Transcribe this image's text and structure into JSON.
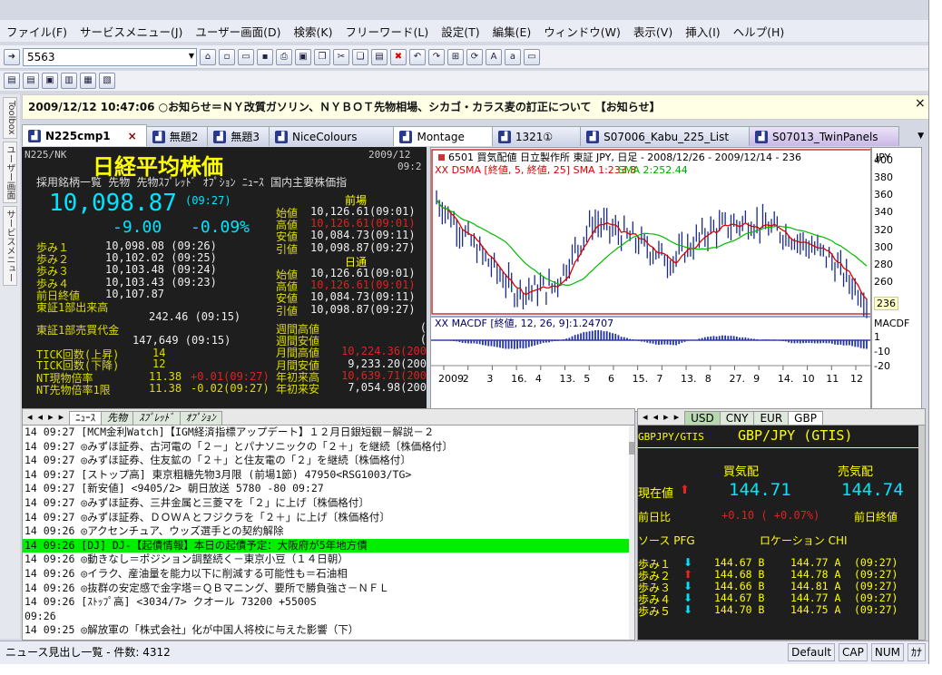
{
  "menu": [
    "ファイル(F)",
    "サービスメニュー(J)",
    "ユーザー画面(D)",
    "検索(K)",
    "フリーワード(L)",
    "設定(T)",
    "編集(E)",
    "ウィンドウ(W)",
    "表示(V)",
    "挿入(I)",
    "ヘルプ(H)"
  ],
  "address": {
    "value": "5563"
  },
  "notice": {
    "text": "2009/12/12 10:47:06 ○お知らせ＝ＮＹ改質ガソリン、ＮＹＢＯＴ先物相場、シカゴ・カラス麦の訂正について 【お知らせ】",
    "close": "×"
  },
  "left_strip": [
    "Toolbox",
    "ユーザー画面",
    "サービスメニュー"
  ],
  "tabs": [
    {
      "label": "N225cmp1",
      "active": true,
      "close": "×"
    },
    {
      "label": "無題2"
    },
    {
      "label": "無題3"
    },
    {
      "label": "NiceColours"
    },
    {
      "label": "Montage"
    },
    {
      "label": "1321①"
    },
    {
      "label": "S07006_Kabu_225_List"
    },
    {
      "label": "S07013_TwinPanels"
    }
  ],
  "quote": {
    "code": "N225/NK",
    "date": "2009/12",
    "time": "09:2",
    "title": "日経平均株価",
    "links": "採用銘柄一覧 先物 先物ｽﾌﾟﾚｯﾄﾞ ｵﾌﾟｼｮﾝ ﾆｭｰｽ 国内主要株価指",
    "price": "10,098.87",
    "price_time": "(09:27)",
    "change": "-9.00",
    "change_pct": "-0.09%",
    "steps": [
      {
        "label": "歩み１",
        "value": "10,098.08 (09:26)"
      },
      {
        "label": "歩み２",
        "value": "10,102.02 (09:25)"
      },
      {
        "label": "歩み３",
        "value": "10,103.48 (09:24)"
      },
      {
        "label": "歩み４",
        "value": "10,103.43 (09:23)"
      },
      {
        "label": "前日終値",
        "value": "10,107.87"
      }
    ],
    "zenba": "前場",
    "sessions_am": [
      {
        "label": "始値",
        "value": "10,126.61(09:01)"
      },
      {
        "label": "高値",
        "value": "10,126.61(09:01)"
      },
      {
        "label": "安値",
        "value": "10,084.73(09:11)"
      },
      {
        "label": "引値",
        "value": "10,098.87(09:27)"
      }
    ],
    "hidori": "日通",
    "sessions_day": [
      {
        "label": "始値",
        "value": "10,126.61(09:01)"
      },
      {
        "label": "高値",
        "value": "10,126.61(09:01)"
      },
      {
        "label": "安値",
        "value": "10,084.73(09:11)"
      },
      {
        "label": "引値",
        "value": "10,098.87(09:27)"
      }
    ],
    "tse_label": "東証1部出来高",
    "tse_value": "242.46 (09:15)",
    "tse_amt_label": "東証1部売買代金",
    "tse_amt_value": "147,649 (09:15)",
    "tick_up": "TICK回数(上昇)",
    "tick_up_v": "14",
    "tick_dn": "TICK回数(下降)",
    "tick_dn_v": "12",
    "nt1": "NT現物倍率",
    "nt1_v": "11.38",
    "nt1_c": "+0.01(09:27)",
    "nt2": "NT先物倍率1限",
    "nt2_v": "11.38",
    "nt2_c": "-0.02(09:27)",
    "weekly": [
      {
        "label": "週間高値",
        "value": "("
      },
      {
        "label": "週間安値",
        "value": "("
      },
      {
        "label": "月間高値",
        "value": "10,224.36(200"
      },
      {
        "label": "月間安値",
        "value": "9,233.20(200"
      },
      {
        "label": "年初来高",
        "value": "10,639.71(200"
      },
      {
        "label": "年初来安",
        "value": "7,054.98(200"
      }
    ]
  },
  "chart": {
    "header": "6501 買気配値 日立製作所 東証 JPY, 日足 - 2008/12/26 - 2009/12/14 - 236",
    "ma_label": "XX DSMA [終値, 5, 終値, 25] SMA 1:233.8",
    "ma2_label": "SMA 2:252.44",
    "currency": "JPY",
    "macd_label": "XX MACDF [終値, 12, 26, 9]:1.24707",
    "macd_axis": "MACDF",
    "price_ticks": [
      "400",
      "380",
      "360",
      "340",
      "320",
      "300",
      "280",
      "260",
      "236"
    ],
    "macd_ticks": [
      "1",
      "-10",
      "-20"
    ],
    "x_ticks": [
      "2009",
      "2",
      "3",
      "16.",
      "4",
      "13.",
      "5",
      "6",
      "15.",
      "7",
      "13.",
      "8",
      "27.",
      "9",
      "14.",
      "10",
      "11",
      "12"
    ]
  },
  "chart_data": {
    "type": "line",
    "title": "6501 買気配値 日立製作所 東証 JPY, 日足 - 2008/12/26 - 2009/12/14 - 236",
    "x": [
      "2009",
      "2",
      "3",
      "4",
      "5",
      "6",
      "7",
      "8",
      "9",
      "10",
      "11",
      "12"
    ],
    "series": [
      {
        "name": "終値",
        "values": [
          355,
          300,
          250,
          255,
          330,
          310,
          285,
          320,
          330,
          315,
          290,
          240
        ]
      }
    ],
    "ylim": [
      225,
      410
    ]
  },
  "news": {
    "tabs": [
      "ﾆｭｰｽ",
      "先物",
      "ｽﾌﾟﾚｯﾄﾞ",
      "ｵﾌﾟｼｮﾝ"
    ],
    "rows": [
      "14 09:27 [MCM金利Watch]【IGM経済指標アップデート】１２月日銀短観－解説－２",
      "14 09:27 ◎みずほ証券、古河電の「２－」とパナソニックの「２＋」を継続〔株価格付〕",
      "14 09:27 ◎みずほ証券、住友鉱の「２＋」と住友電の「２」を継続〔株価格付〕",
      "14 09:27 [ストップ高] 東京粗糖先物3月限 (前場1節) 47950<RSG1003/TG>",
      "14 09:27 [新安値] <9405/2> 朝日放送 5780 -80 09:27",
      "14 09:27 ◎みずほ証券、三井金属と三菱マを「２」に上げ〔株価格付〕",
      "14 09:27 ◎みずほ証券、ＤＯＷＡとフジクラを「２＋」に上げ〔株価格付〕",
      "14 09:26 ◎アクセンチュア、ウッズ選手との契約解除",
      "14 09:26 [DJ] DJ-【起債情報】本日の起債予定：大阪府が5年地方債",
      "14 09:26 ◎動きなし＝ポジション調整続く－東京小豆（１４日朝）",
      "14 09:26 ◎イラク、産油量を能力以下に削減する可能性も＝石油相",
      "14 09:26 ◎抜群の安定感で金字塔＝ＱＢマニング、要所で勝負強さ－ＮＦＬ",
      "14 09:26 [ｽﾄｯﾌﾟ高] <3034/7> クオール 73200 +5500S",
      "         09:26",
      "14 09:25 ◎解放軍の「株式会社」化が中国人将校に与えた影響（下）"
    ],
    "highlight_index": 8
  },
  "fx": {
    "tabs": [
      "USD",
      "CNY",
      "EUR",
      "GBP"
    ],
    "code": "GBPJPY/GTIS",
    "title": "GBP/JPY (GTIS)",
    "bid_label": "買気配",
    "ask_label": "売気配",
    "now_label": "現在値",
    "bid": "144.71",
    "ask": "144.74",
    "prev_label": "前日比",
    "prev_val": "+0.10 ( +0.07%)",
    "prev_close_label": "前日終値",
    "src_label": "ソース PFG",
    "loc_label": "ロケーション CHI",
    "steps": [
      {
        "label": "歩み１",
        "bid": "144.67 B",
        "ask": "144.77 A",
        "time": "(09:27)"
      },
      {
        "label": "歩み２",
        "bid": "144.68 B",
        "ask": "144.78 A",
        "time": "(09:27)"
      },
      {
        "label": "歩み３",
        "bid": "144.66 B",
        "ask": "144.81 A",
        "time": "(09:27)"
      },
      {
        "label": "歩み４",
        "bid": "144.67 B",
        "ask": "144.77 A",
        "time": "(09:27)"
      },
      {
        "label": "歩み５",
        "bid": "144.70 B",
        "ask": "144.75 A",
        "time": "(09:27)"
      }
    ]
  },
  "status": {
    "text": "ニュース見出し一覧 - 件数: 4312",
    "default": "Default",
    "cap": "CAP",
    "num": "NUM",
    "kana": "ｶﾅ"
  }
}
